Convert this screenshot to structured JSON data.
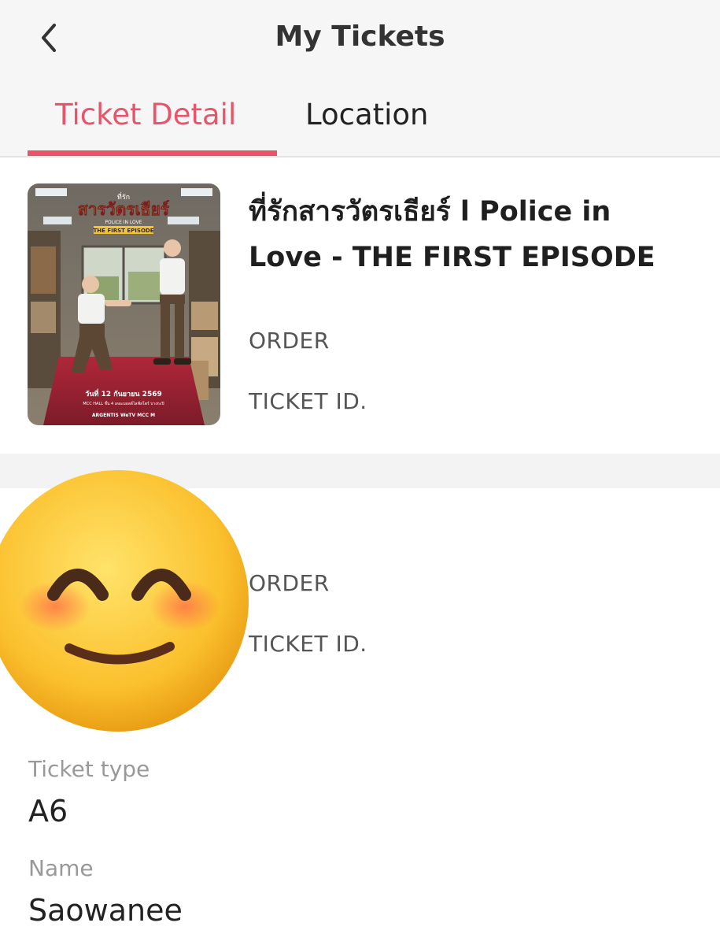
{
  "header": {
    "title": "My Tickets",
    "back_icon": "chevron-left-icon",
    "tabs": [
      {
        "label": "Ticket Detail",
        "active": true
      },
      {
        "label": "Location",
        "active": false
      }
    ],
    "accent_color": "#e8546a"
  },
  "event": {
    "title_line1": "ที่รักสารวัตรเธียร์ l Police in",
    "title_line2": "Love - THE FIRST EPISODE",
    "poster": {
      "small_title": "ที่รัก",
      "title": "สารวัตรเธียร์",
      "subtitle": "POLICE IN LOVE",
      "episode": "THE FIRST EPISODE",
      "date": "วันที่ 12 กันยายน 2569",
      "venue": "MCC HALL ชั้น 4 เดอะมอลล์ไลฟ์สโตร์ บางกะปิ",
      "sponsors": "ARGENTIS  WeTV  MCC  M"
    }
  },
  "ticket1": {
    "order_label": "ORDER",
    "ticket_id_label": "TICKET ID."
  },
  "ticket2": {
    "order_label": "ORDER",
    "ticket_id_label": "TICKET ID."
  },
  "details": {
    "ticket_type_label": "Ticket type",
    "ticket_type_value": "A6",
    "name_label": "Name",
    "name_value": "Saowanee"
  },
  "overlay": {
    "icon": "smiling-face-emoji-icon"
  }
}
